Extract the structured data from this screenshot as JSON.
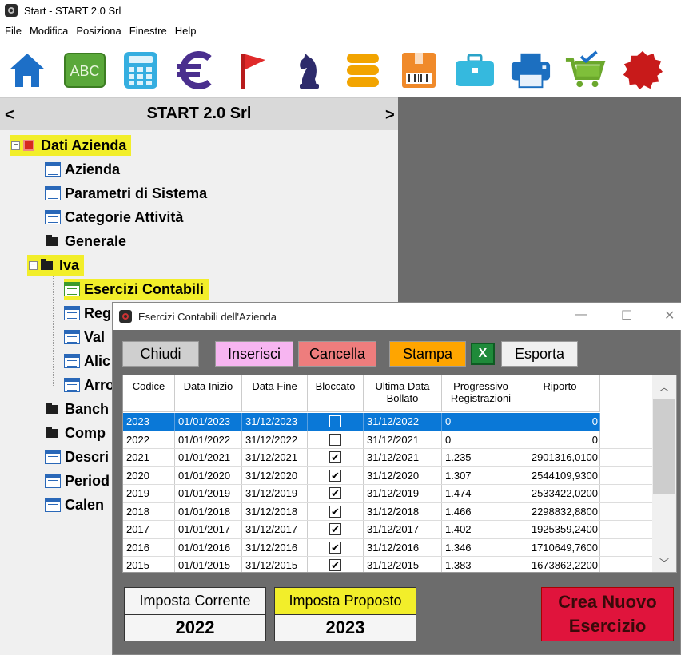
{
  "window": {
    "title": "Start - START 2.0 Srl"
  },
  "menu": [
    "File",
    "Modifica",
    "Posiziona",
    "Finestre",
    "Help"
  ],
  "toolbar_icons": [
    "home-icon",
    "abc-icon",
    "calculator-icon",
    "euro-icon",
    "flag-icon",
    "chess-knight-icon",
    "coins-stack-icon",
    "barcode-box-icon",
    "briefcase-icon",
    "printer-icon",
    "cart-check-icon",
    "red-seal-icon"
  ],
  "toolbar_labels": {
    "abc": "ABC"
  },
  "left_panel": {
    "prev": "<",
    "next": ">",
    "company": "START 2.0 Srl",
    "tree": [
      {
        "label": "Dati Azienda"
      },
      {
        "label": "Azienda"
      },
      {
        "label": "Parametri di Sistema"
      },
      {
        "label": "Categorie Attività"
      },
      {
        "label": "Generale"
      },
      {
        "label": "Iva"
      },
      {
        "label": "Esercizi Contabili"
      },
      {
        "label": "Reg"
      },
      {
        "label": "Val"
      },
      {
        "label": "Alic"
      },
      {
        "label": "Arro"
      },
      {
        "label": "Banch"
      },
      {
        "label": "Comp"
      },
      {
        "label": "Descri"
      },
      {
        "label": "Period"
      },
      {
        "label": "Calen"
      }
    ]
  },
  "dialog": {
    "title": "Esercizi Contabili dell'Azienda",
    "buttons": {
      "chiudi": "Chiudi",
      "inserisci": "Inserisci",
      "cancella": "Cancella",
      "stampa": "Stampa",
      "excel": "X",
      "esporta": "Esporta"
    },
    "colors": {
      "inserisci": "#f7b5f1",
      "cancella": "#ee7d7d",
      "stampa": "#ffa500",
      "crea": "#e0143c",
      "selected": "#0a78d7",
      "highlight": "#f2ee2a"
    },
    "columns": [
      "Codice",
      "Data Inizio",
      "Data Fine",
      "Bloccato",
      "Ultima Data Bollato",
      "Progressivo Registrazioni",
      "Riporto"
    ],
    "rows": [
      {
        "codice": "2023",
        "inizio": "01/01/2023",
        "fine": "31/12/2023",
        "bloccato": "",
        "bollato": "31/12/2022",
        "progressivo": "0",
        "riporto": "0"
      },
      {
        "codice": "2022",
        "inizio": "01/01/2022",
        "fine": "31/12/2022",
        "bloccato": "",
        "bollato": "31/12/2021",
        "progressivo": "0",
        "riporto": "0"
      },
      {
        "codice": "2021",
        "inizio": "01/01/2021",
        "fine": "31/12/2021",
        "bloccato": "✔",
        "bollato": "31/12/2021",
        "progressivo": "1.235",
        "riporto": "2901316,0100"
      },
      {
        "codice": "2020",
        "inizio": "01/01/2020",
        "fine": "31/12/2020",
        "bloccato": "✔",
        "bollato": "31/12/2020",
        "progressivo": "1.307",
        "riporto": "2544109,9300"
      },
      {
        "codice": "2019",
        "inizio": "01/01/2019",
        "fine": "31/12/2019",
        "bloccato": "✔",
        "bollato": "31/12/2019",
        "progressivo": "1.474",
        "riporto": "2533422,0200"
      },
      {
        "codice": "2018",
        "inizio": "01/01/2018",
        "fine": "31/12/2018",
        "bloccato": "✔",
        "bollato": "31/12/2018",
        "progressivo": "1.466",
        "riporto": "2298832,8800"
      },
      {
        "codice": "2017",
        "inizio": "01/01/2017",
        "fine": "31/12/2017",
        "bloccato": "✔",
        "bollato": "31/12/2017",
        "progressivo": "1.402",
        "riporto": "1925359,2400"
      },
      {
        "codice": "2016",
        "inizio": "01/01/2016",
        "fine": "31/12/2016",
        "bloccato": "✔",
        "bollato": "31/12/2016",
        "progressivo": "1.346",
        "riporto": "1710649,7600"
      },
      {
        "codice": "2015",
        "inizio": "01/01/2015",
        "fine": "31/12/2015",
        "bloccato": "✔",
        "bollato": "31/12/2015",
        "progressivo": "1.383",
        "riporto": "1673862,2200"
      }
    ],
    "imposta_corrente": {
      "label": "Imposta Corrente",
      "value": "2022"
    },
    "imposta_proposto": {
      "label": "Imposta Proposto",
      "value": "2023"
    },
    "crea_line1": "Crea Nuovo",
    "crea_line2": "Esercizio"
  }
}
